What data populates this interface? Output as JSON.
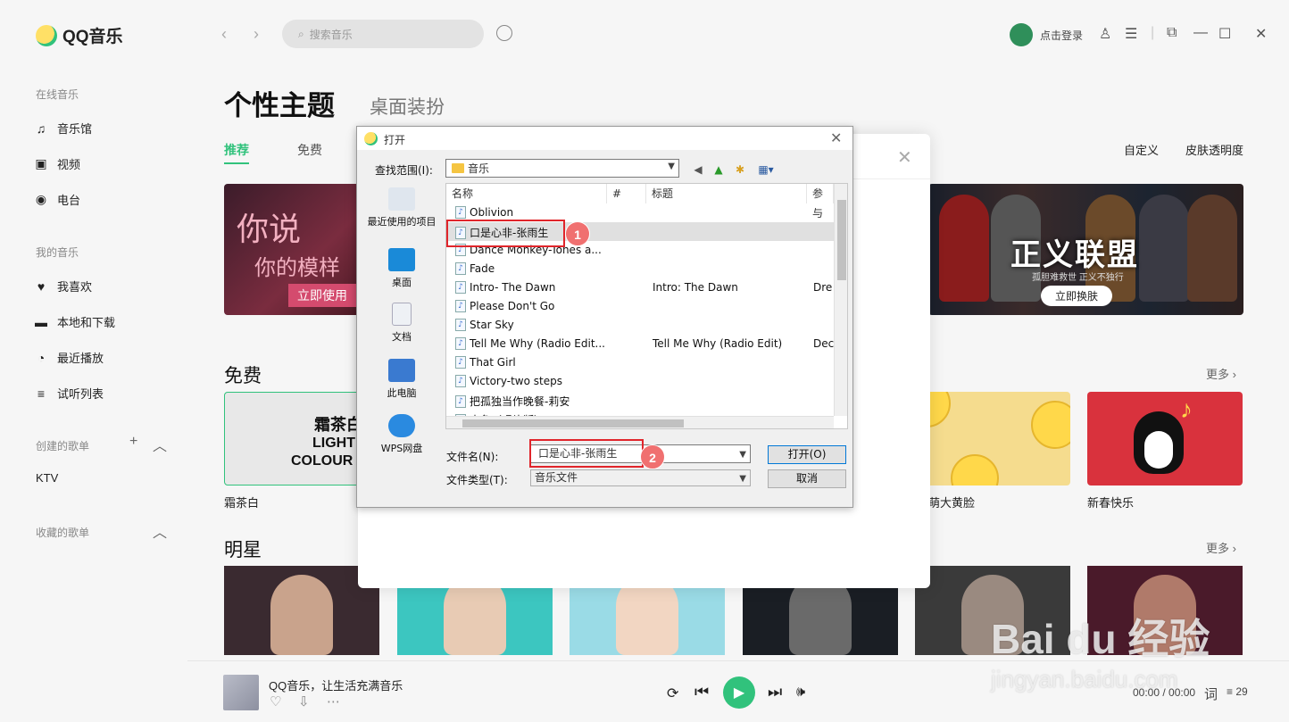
{
  "app": {
    "logo_text": "QQ音乐",
    "search_placeholder": "搜索音乐",
    "login_label": "点击登录"
  },
  "sidebar": {
    "online_section": "在线音乐",
    "online_items": [
      "音乐馆",
      "视频",
      "电台"
    ],
    "my_section": "我的音乐",
    "my_items": [
      "我喜欢",
      "本地和下载",
      "最近播放",
      "试听列表"
    ],
    "created_section": "创建的歌单",
    "created_items": [
      "KTV"
    ],
    "collected_section": "收藏的歌单"
  },
  "main": {
    "title": "个性主题",
    "subtitle": "桌面装扮",
    "tabs": [
      "推荐",
      "免费"
    ],
    "right_links": [
      "自定义",
      "皮肤透明度"
    ],
    "banner_left": {
      "line1": "你说",
      "line2": "你的模样",
      "button": "立即使用"
    },
    "banner_right": {
      "title": "正义联盟",
      "sub": "孤胆难救世  正义不独行",
      "button": "立即换肤"
    },
    "free_section": "免费",
    "more_label": "更多",
    "free_cards": [
      {
        "caption": "霜茶白",
        "lines": [
          "霜茶白",
          "LIGHT",
          "COLOUR"
        ]
      },
      {
        "caption": "萌大黄脸"
      },
      {
        "caption": "新春快乐"
      }
    ],
    "star_section": "明星"
  },
  "player": {
    "song": "QQ音乐，让生活充满音乐",
    "time": "00:00 / 00:00",
    "lyrics_icon": "词",
    "list_count": "29"
  },
  "dialog": {
    "title": "打开",
    "lookin_label": "查找范围(I):",
    "lookin_value": "音乐",
    "places": [
      "最近使用的项目",
      "桌面",
      "文档",
      "此电脑",
      "WPS网盘"
    ],
    "columns": [
      "名称",
      "#",
      "标题",
      "参与"
    ],
    "files": [
      {
        "name": "Oblivion",
        "title": "",
        "artist": ""
      },
      {
        "name": "口是心非-张雨生",
        "title": "",
        "artist": ""
      },
      {
        "name": "Dance Monkey-Tones a...",
        "title": "",
        "artist": ""
      },
      {
        "name": "Fade",
        "title": "",
        "artist": ""
      },
      {
        "name": "Intro- The Dawn",
        "title": "Intro: The Dawn",
        "artist": "Dre"
      },
      {
        "name": "Please Don't Go",
        "title": "",
        "artist": ""
      },
      {
        "name": "Star Sky",
        "title": "",
        "artist": ""
      },
      {
        "name": "Tell Me Why (Radio Edit...",
        "title": "Tell Me Why (Radio Edit)",
        "artist": "Dec"
      },
      {
        "name": "That Girl",
        "title": "",
        "artist": ""
      },
      {
        "name": "Victory-two steps",
        "title": "",
        "artist": ""
      },
      {
        "name": "把孤独当作晚餐-莉安",
        "title": "",
        "artist": ""
      },
      {
        "name": "大鱼（唱片版）",
        "title": "",
        "artist": ""
      }
    ],
    "filename_label": "文件名(N):",
    "filename_value": "口是心非-张雨生",
    "filetype_label": "文件类型(T):",
    "filetype_value": "音乐文件",
    "open_button": "打开(O)",
    "cancel_button": "取消"
  },
  "annotations": {
    "badge1": "1",
    "badge2": "2"
  },
  "watermark": {
    "line1": "Bai du 经验",
    "line2": "jingyan.baidu.com"
  },
  "colors": {
    "accent": "#31c27c",
    "highlight": "#e0252b",
    "badge": "#f07070"
  }
}
